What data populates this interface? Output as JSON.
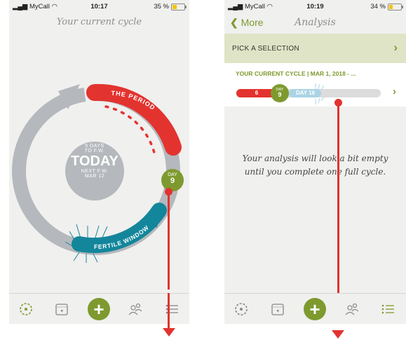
{
  "screen1": {
    "status": {
      "carrier": "MyCall",
      "time": "10:17",
      "battery": "35 %"
    },
    "title": "Your current cycle",
    "center": {
      "line1": "5 DAYS",
      "line2": "TO F.W.",
      "today": "TODAY",
      "line3": "NEXT F.W.",
      "line4": "MAR 12"
    },
    "period_label": "THE PERIOD",
    "fertile_label": "FERTILE WINDOW",
    "day_badge": {
      "label": "DAY",
      "value": "9"
    }
  },
  "screen2": {
    "status": {
      "carrier": "MyCall",
      "time": "10:19",
      "battery": "34 %"
    },
    "back_label": "More",
    "title": "Analysis",
    "pick_label": "PICK A SELECTION",
    "cycle_label": "YOUR CURRENT CYCLE | MAR 1, 2018 - ...",
    "bar": {
      "period_value": "6",
      "day_label": "DAY",
      "day_value": "9",
      "fertile_label": "DAY 16"
    },
    "empty_message_line1": "Your analysis will look a bit empty",
    "empty_message_line2": "until you complete one full cycle."
  },
  "tabbar": {
    "icons": [
      "cycle-icon",
      "calendar-icon",
      "add-icon",
      "people-icon",
      "list-icon"
    ],
    "plus": "+"
  },
  "colors": {
    "green": "#7e9a2f",
    "red": "#e3332f",
    "teal": "#13869b",
    "gray": "#b5b8bc",
    "blue": "#a9d4e4"
  }
}
